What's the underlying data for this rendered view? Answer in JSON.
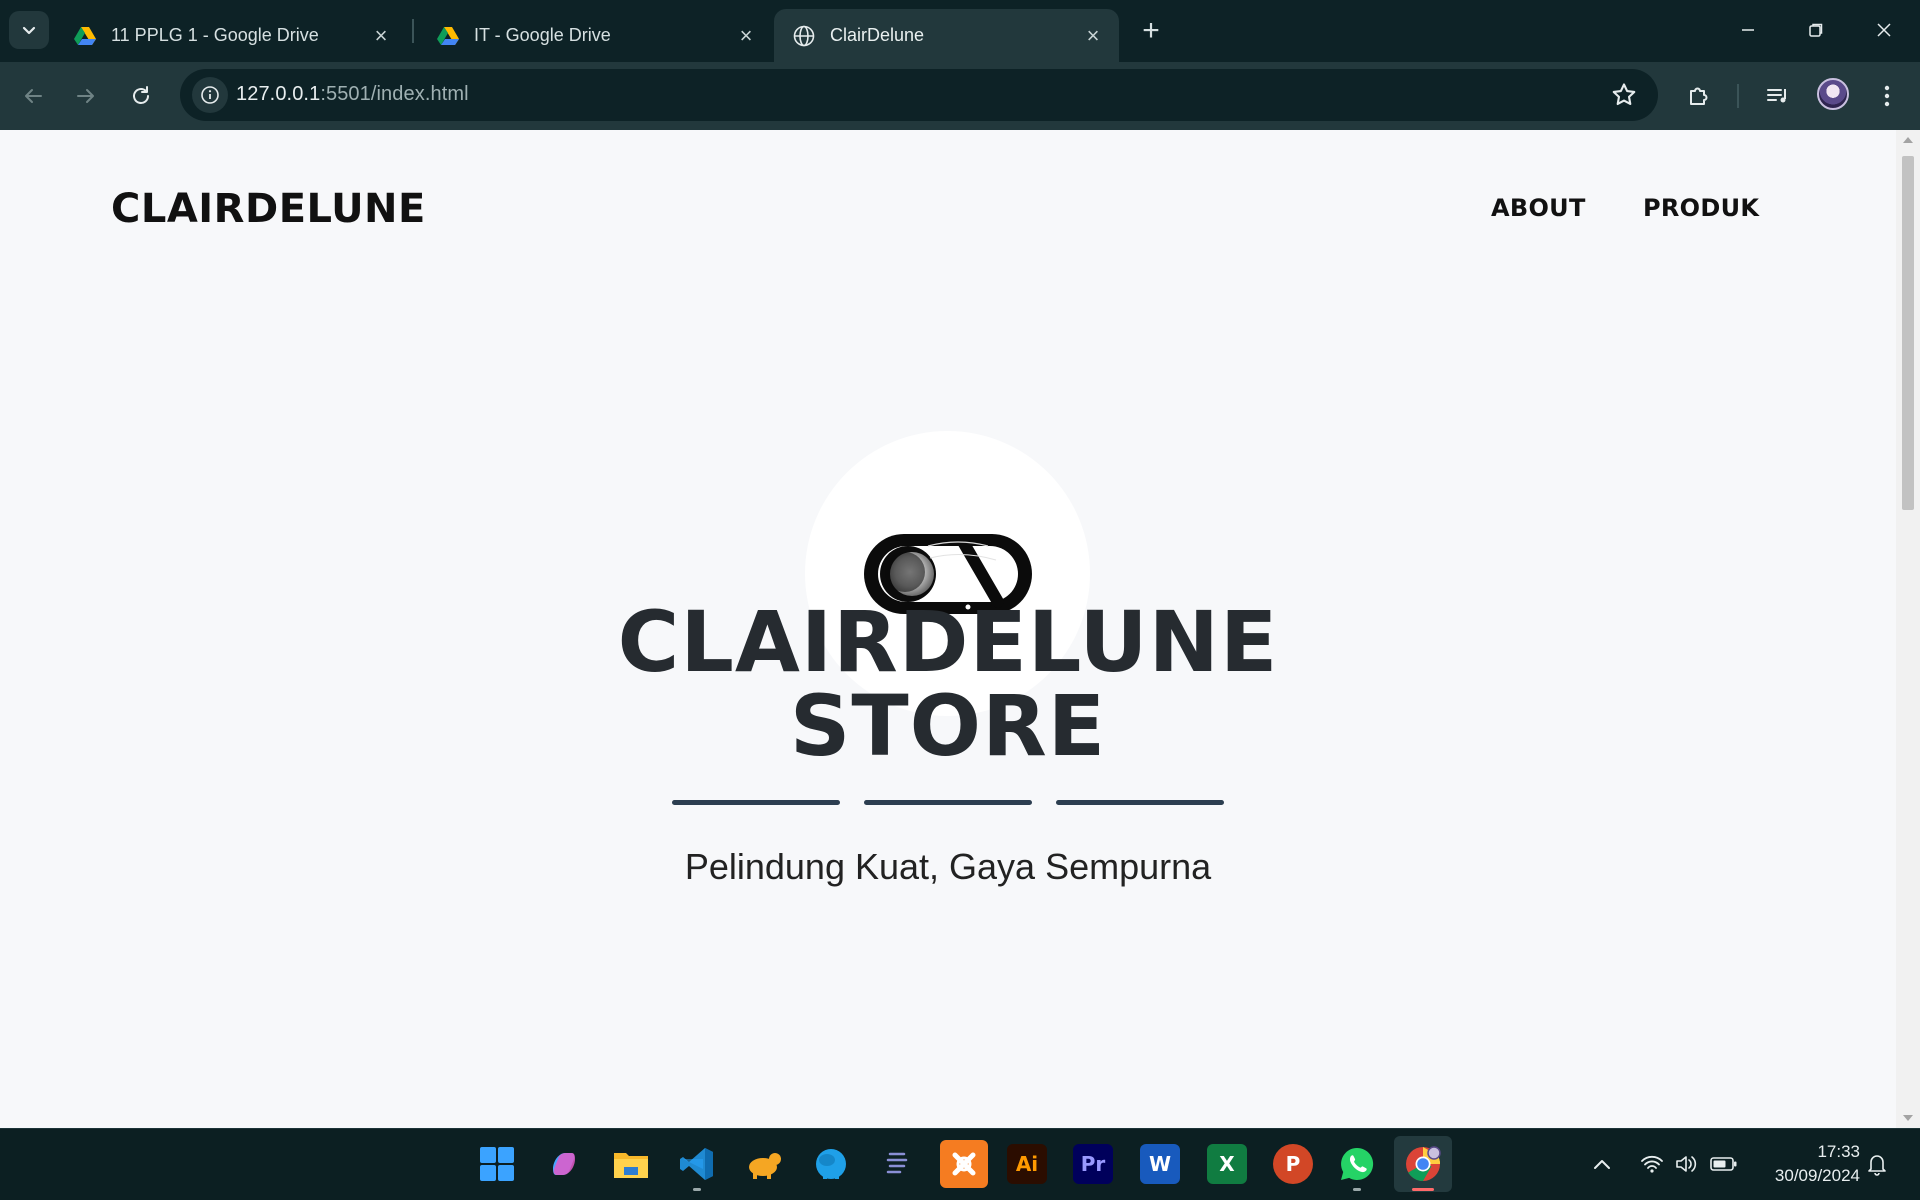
{
  "browser": {
    "tabs": [
      {
        "title": "11 PPLG 1 - Google Drive",
        "icon": "google-drive-icon",
        "active": false
      },
      {
        "title": "IT - Google Drive",
        "icon": "google-drive-icon",
        "active": false
      },
      {
        "title": "ClairDelune",
        "icon": "globe-icon",
        "active": true
      }
    ],
    "url_host": "127.0.0.1",
    "url_rest": ":5501/index.html",
    "colors": {
      "frame": "#0d2226",
      "toolbar": "#22383c"
    }
  },
  "site": {
    "brand": "CLAIRDELUNE",
    "nav": [
      "ABOUT",
      "PRODUK"
    ],
    "hero_title_line1": "CLAIRDELUNE",
    "hero_title_line2": "STORE",
    "tagline": "Pelindung Kuat, Gaya Sempurna",
    "colors": {
      "background": "#f7f8fa",
      "heading": "#262b30",
      "divider": "#2c3e50"
    }
  },
  "taskbar": {
    "apps": [
      "windows-start-icon",
      "copilot-icon",
      "file-explorer-icon",
      "vscode-icon",
      "tableplus-icon",
      "mysql-workbench-icon",
      "sublime-text-icon",
      "xampp-icon",
      "illustrator-icon",
      "premiere-icon",
      "word-icon",
      "excel-icon",
      "powerpoint-icon",
      "whatsapp-icon",
      "chrome-icon"
    ],
    "labels": {
      "illustrator": "Ai",
      "premiere": "Pr",
      "word": "W",
      "excel": "X",
      "powerpoint": "P"
    },
    "time": "17:33",
    "date": "30/09/2024"
  }
}
